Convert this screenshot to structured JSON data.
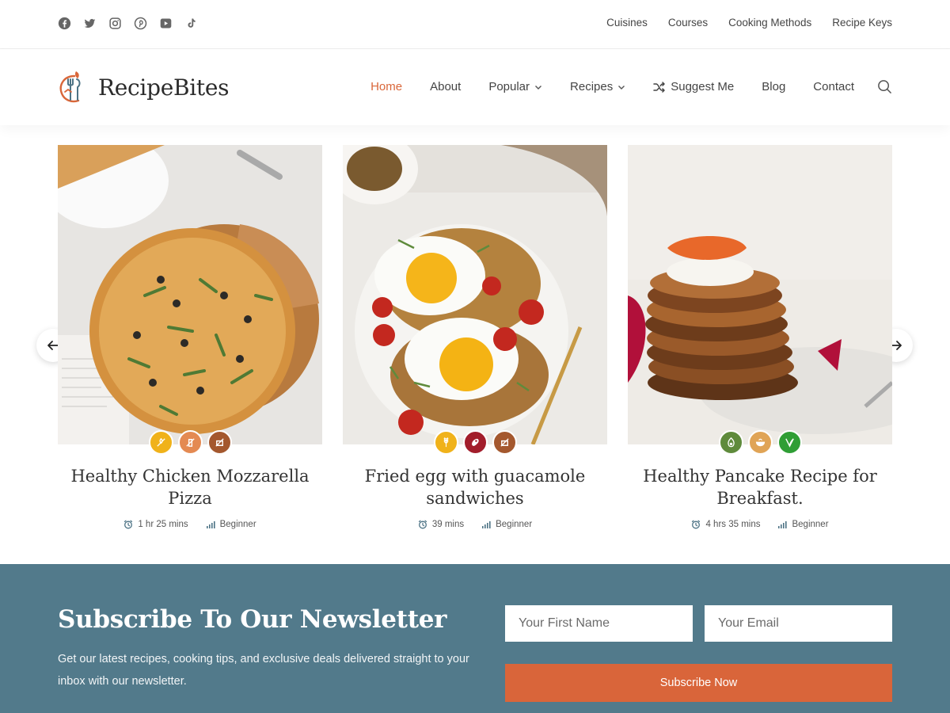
{
  "topbar": {
    "socials": [
      "facebook-icon",
      "twitter-icon",
      "instagram-icon",
      "pinterest-icon",
      "youtube-icon",
      "tiktok-icon"
    ],
    "links": [
      "Cuisines",
      "Courses",
      "Cooking Methods",
      "Recipe Keys"
    ]
  },
  "header": {
    "logo_text": "RecipeBites",
    "nav": [
      {
        "label": "Home",
        "active": true
      },
      {
        "label": "About"
      },
      {
        "label": "Popular",
        "dropdown": true
      },
      {
        "label": "Recipes",
        "dropdown": true
      },
      {
        "label": "Suggest Me",
        "icon": "shuffle-icon"
      },
      {
        "label": "Blog"
      },
      {
        "label": "Contact"
      }
    ],
    "accent_color": "#d9673a"
  },
  "recipes": [
    {
      "title": "Healthy Chicken Mozzarella Pizza",
      "time": "1 hr 25 mins",
      "level": "Beginner",
      "badges": [
        {
          "icon": "no-gluten-icon",
          "color": "#f0b21a"
        },
        {
          "icon": "no-dairy-icon",
          "color": "#e48a52"
        },
        {
          "icon": "no-meat-icon",
          "color": "#a4582e"
        }
      ]
    },
    {
      "title": "Fried egg with guacamole sandwiches",
      "time": "39 mins",
      "level": "Beginner",
      "badges": [
        {
          "icon": "grain-icon",
          "color": "#f0b21a"
        },
        {
          "icon": "meat-icon",
          "color": "#a21d2b"
        },
        {
          "icon": "no-meat-icon",
          "color": "#a4582e"
        }
      ]
    },
    {
      "title": "Healthy Pancake Recipe for Breakfast.",
      "time": "4 hrs 35 mins",
      "level": "Beginner",
      "badges": [
        {
          "icon": "avocado-icon",
          "color": "#5f8b3c"
        },
        {
          "icon": "bowl-icon",
          "color": "#e0a456"
        },
        {
          "icon": "vegan-leaf-icon",
          "color": "#2f9e35"
        }
      ]
    }
  ],
  "newsletter": {
    "title": "Subscribe To Our Newsletter",
    "description": "Get our latest recipes, cooking tips, and exclusive deals delivered straight to your inbox with our newsletter.",
    "first_name_placeholder": "Your First Name",
    "email_placeholder": "Your Email",
    "button_label": "Subscribe Now",
    "bg_color": "#527a8b",
    "button_color": "#d9653a"
  }
}
